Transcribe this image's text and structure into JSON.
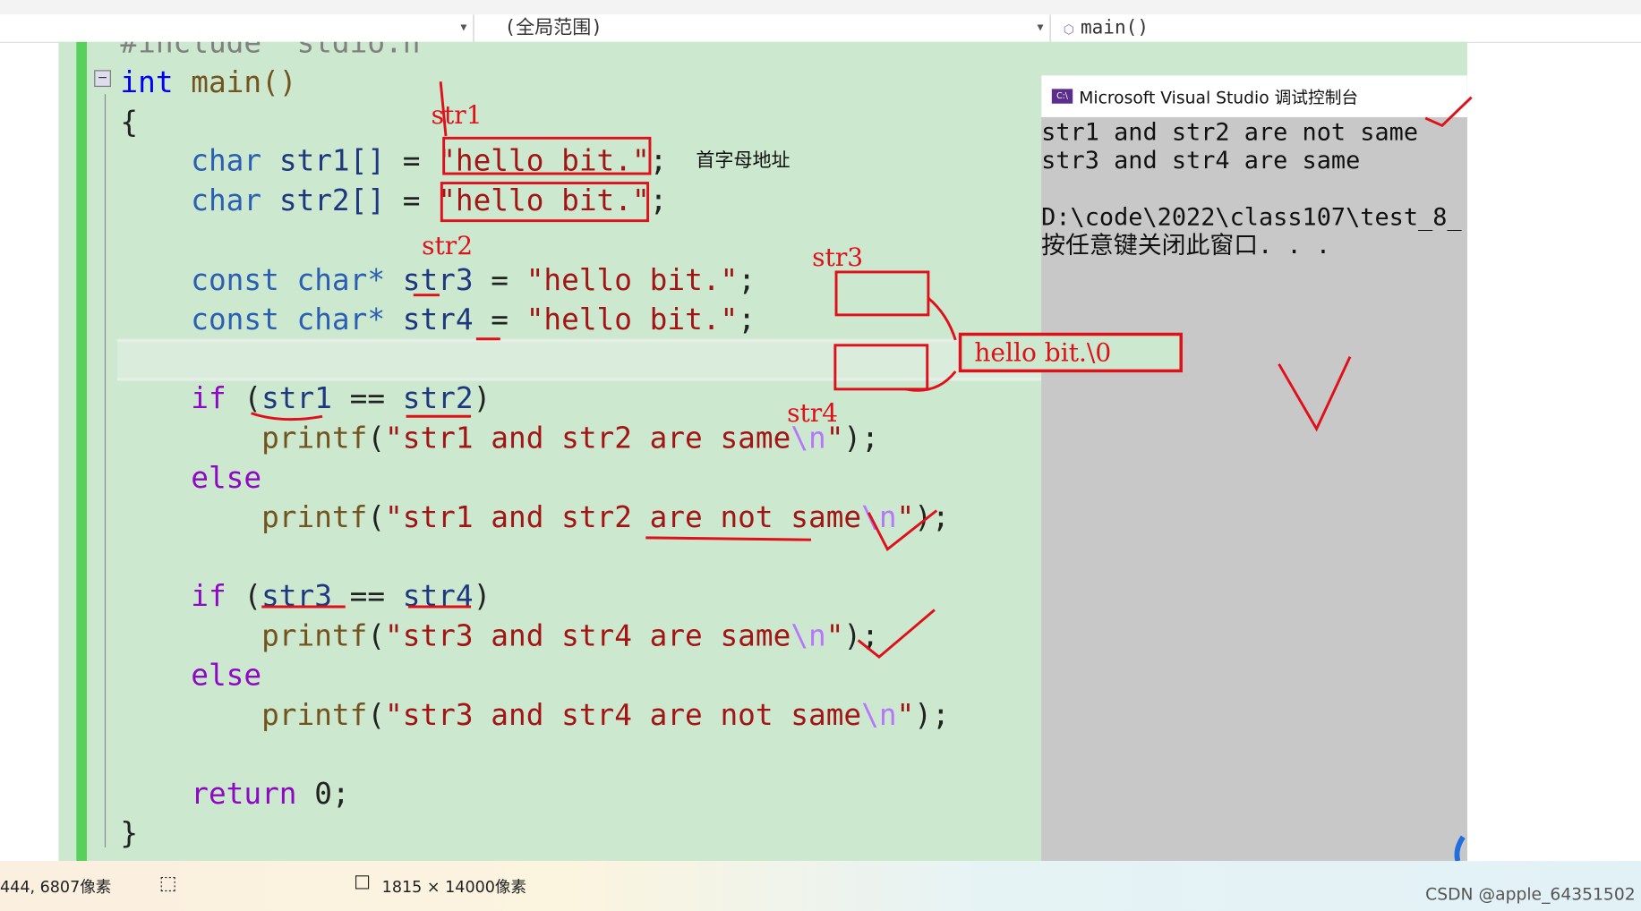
{
  "navbar": {
    "scope": "(全局范围)",
    "function": "main()"
  },
  "code": {
    "include": "#include \"stdio.h\"",
    "lines": [
      "int main()",
      "{",
      "char str1[] = ",
      "\"hello bit.\"",
      "char str2[] = ",
      "const char* ",
      "str3",
      " = ",
      "str4",
      "if (",
      "str1",
      " == ",
      "str2",
      ")",
      "printf(",
      "\"str1 and str2 are same",
      "\\n",
      "\");",
      "else",
      "\"str1 and str2 are not same",
      "\"str3 and str4 are same",
      "\"str3 and str4 are not same",
      "return 0;",
      "}"
    ]
  },
  "console": {
    "title": "Microsoft Visual Studio 调试控制台",
    "icon": "C:\\",
    "output": [
      "str1 and str2 are not same",
      "str3 and str4 are same",
      "",
      "D:\\code\\2022\\class107\\test_8_",
      "按任意键关闭此窗口. . ."
    ]
  },
  "annotations": {
    "str1": "str1",
    "str2": "str2",
    "str3": "str3",
    "str4": "str4",
    "note": "首字母地址",
    "memory": "hello bit.\\0"
  },
  "status": {
    "position": "444, 6807像素",
    "size": "1815 × 14000像素",
    "watermark": "CSDN @apple_64351502"
  },
  "colors": {
    "editor_bg": "#cce8cf",
    "annotation": "#e0101a",
    "keyword": "#0000ff",
    "string": "#a31515"
  }
}
